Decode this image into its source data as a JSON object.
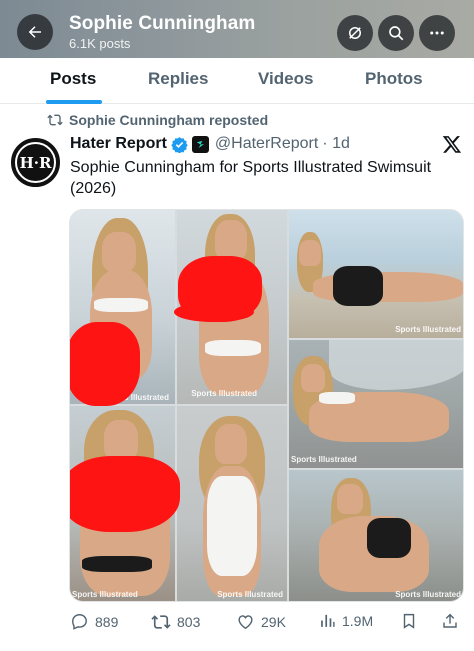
{
  "header": {
    "title": "Sophie Cunningham",
    "subtitle": "6.1K posts",
    "back_icon": "back-arrow-icon",
    "sync_icon": "sync-icon",
    "search_icon": "search-icon",
    "more_icon": "more-icon"
  },
  "tabs": [
    {
      "label": "Posts",
      "active": true
    },
    {
      "label": "Replies",
      "active": false
    },
    {
      "label": "Videos",
      "active": false
    },
    {
      "label": "Photos",
      "active": false
    }
  ],
  "post": {
    "repost_label": "Sophie Cunningham reposted",
    "avatar_text": "H·R",
    "author_name": "Hater Report",
    "author_handle": "@HaterReport",
    "time": "· 1d",
    "text": "Sophie Cunningham for Sports Illustrated Swimsuit (2026)",
    "watermark": "Sports Illustrated",
    "actions": {
      "replies": "889",
      "reposts": "803",
      "likes": "29K",
      "views": "1.9M"
    }
  },
  "colors": {
    "accent": "#1d9bf0",
    "verified": "#1d9bf0",
    "redaction": "#ff1414",
    "secondary_text": "#536471"
  }
}
